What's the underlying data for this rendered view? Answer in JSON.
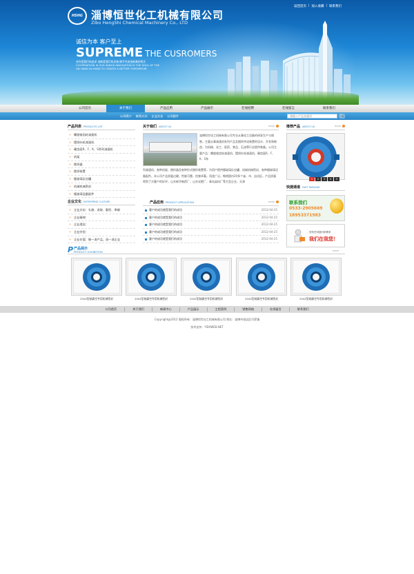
{
  "header": {
    "logo_text": "HSHG",
    "company_cn": "淄博恒世化工机械有限公司",
    "company_en": "Zibo HengShi Chemical Machinery Co., LTD",
    "top_links": [
      "返回首页",
      "|",
      "加入收藏",
      "|",
      "联系我们"
    ],
    "slogan_cn": "诚信为本 客户至上",
    "slogan_big": "SUPREME",
    "slogan_big_rest": "THE CUSROMERS",
    "slogan_sub_1": "合作是我们的追求 创新是我们的灵魂 携手共进创新美好明天",
    "slogan_sub_2": "COOPERATION IS OUR WINGS INNOVATION IS THE SOUL OF THE",
    "slogan_sub_3": "UN HAND IN HAND TO CREATE A BETTER TOMORROW"
  },
  "nav": {
    "items": [
      "公司首页",
      "关于我们",
      "产品应用",
      "产品展示",
      "在线招聘",
      "在线留言",
      "联系我们"
    ]
  },
  "subnav": {
    "links": [
      "公司简介",
      "联系方式",
      "企业文化",
      "公司图片"
    ],
    "search_placeholder": "请输入产品关键词",
    "search_button": "🔍"
  },
  "product_list": {
    "title": "产品列表",
    "title_en": "PRODUCTS LIST",
    "items": [
      "螺旋锥齿轮减速机",
      "摆线针轮减速机",
      "硬齿面R、F、K、S系列减速机",
      "机架",
      "搅拌器",
      "搅拌装置",
      "搪玻璃反应罐",
      "机械机械密封",
      "搪玻璃设备配件"
    ]
  },
  "culture": {
    "title": "企业文化",
    "title_en": "ENTERPRISE CULTURE",
    "items": [
      "企业文化：礼貌、进取、勤俭、奉献",
      "企业精神：",
      "企业理念：",
      "企业宗旨：",
      "企业价值：做一流产品，创一流企业"
    ]
  },
  "about": {
    "title": "关于我们",
    "title_en": "ABOUT US",
    "more": "more",
    "text_1": "淄博恒世化工机械有限公司专业从事化工设备的研发生产与销售，主要从事减速机系列产品及搅拌传动装置的设计、开发和制造，为机械、化工、医药、食品、石油等行业提供装备。公司主要产品：螺旋锥齿轮减速机、摆线针轮减速机、硬齿面R、F、K、S系",
    "text_2": "列减速机、各种机架、搅拌器及各种形式搅拌装置等，为用户提供搪玻璃反应罐、机械机械密封、各种搪玻璃设备配件。本公司产品质量过硬，性能可靠，信誉卓著，用途广泛，畅销国内20多个省、市、自治区，产品质量得到了方客户的好评，山东新华制药厂、山东化肥厂、青岛染料厂等大型企业，天津"
  },
  "application": {
    "title": "产品应用",
    "title_en": "PRODUCT APPLICATION",
    "more": "more",
    "rows": [
      {
        "text": "客户的成功就是我们的成功",
        "date": "2012-04-25"
      },
      {
        "text": "客户的成功就是我们的成功",
        "date": "2012-04-25"
      },
      {
        "text": "客户的成功就是我们的成功",
        "date": "2012-04-25"
      },
      {
        "text": "客户的成功就是我们的成功",
        "date": "2012-04-25"
      },
      {
        "text": "客户的成功就是我们的成功",
        "date": "2012-04-25"
      }
    ]
  },
  "recommend": {
    "title": "推荐产品",
    "title_en": "ABOUT US",
    "more": "more",
    "pages": [
      "1",
      "2",
      "3",
      "4",
      "5"
    ]
  },
  "quick": {
    "title": "快捷通道",
    "title_en": "FAST PASSAGE",
    "contact_title": "联系我们",
    "phone_1": "0533-2905669",
    "phone_2": "18953371983",
    "msg_small": "您有任何疑问和需求",
    "msg_big": "我们在我您！"
  },
  "exhibition": {
    "title": "产品展示",
    "title_en": "PRODUCT EXHIBITION",
    "more": "more",
    "items": [
      "204Z型轴真空专用机械密封",
      "204Z型轴真空专用机械密封",
      "204Z型轴真空专用机械密封",
      "204Z型轴真空专用机械密封",
      "204Z型轴真空专用机械密封"
    ]
  },
  "footer": {
    "nav": [
      "公司首页",
      "关于我们",
      "新闻中心",
      "产品展示",
      "工程案例",
      "销售网络",
      "在线留言",
      "联系我们"
    ],
    "copyright": "Copyright@2012    版权所有：淄博恒世化工机械有限公司    地址：淄博市张店区付家镇",
    "support": "技术支持：YIDAWEB.NET"
  },
  "colors": {
    "brand_blue": "#2a86c8",
    "accent_orange": "#f08a2a",
    "banner_top": "#0b5aa8"
  }
}
